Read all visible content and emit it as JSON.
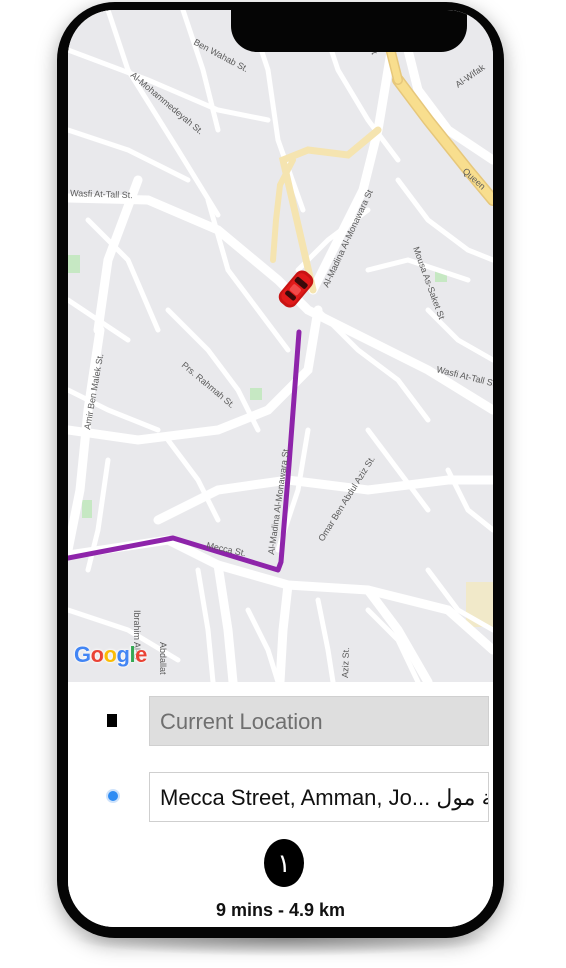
{
  "map": {
    "street_labels": [
      "Ben Wahab St.",
      "Al-Mohammedeyah St.",
      "Wasfi At-Tall St.",
      "Al-Madina Al-Monawara St",
      "Mousa As-Saket St",
      "Wasfi At-Tall St",
      "Amir Ben Malek St.",
      "Prs. Rahmah St.",
      "Al-Madina Al-Monawara St",
      "Omar Ben Abdul Aziz St.",
      "Mecca St.",
      "Ibrahim Al-O",
      "Abdallat",
      "Aziz St.",
      "Al-Wifak",
      "Queen",
      "la St"
    ],
    "google_logo": [
      "G",
      "o",
      "o",
      "g",
      "l",
      "e"
    ],
    "route_color": "#8e24aa",
    "car_color": "#e01a1a"
  },
  "panel": {
    "origin_field": "Current Location",
    "destination_field": "Mecca Street, Amman, Jo... مكة مول،",
    "eta_icon_glyph": "١",
    "eta_text": "9 mins - 4.9 km"
  },
  "icons": {
    "origin": "square-marker-icon",
    "destination": "blue-dot-marker-icon",
    "eta": "clock-icon",
    "car": "car-icon"
  }
}
